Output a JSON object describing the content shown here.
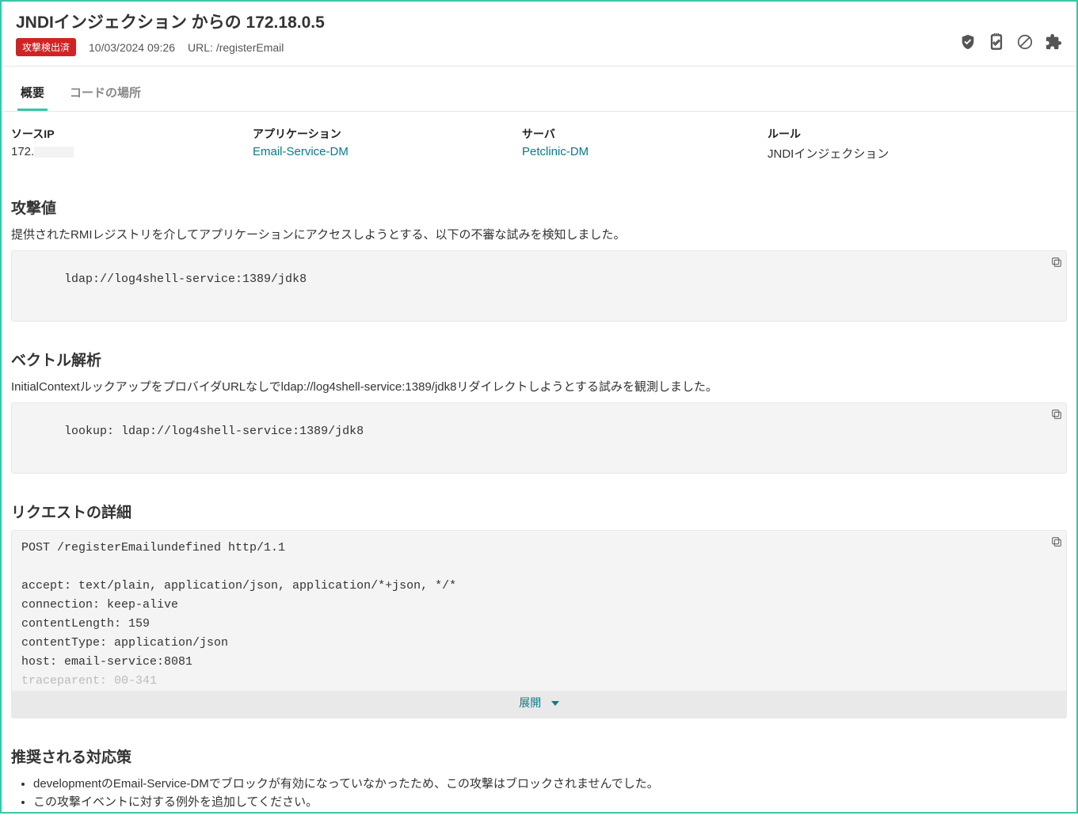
{
  "header": {
    "title": "JNDIインジェクション からの 172.18.0.5",
    "badge": "攻撃検出済",
    "datetime": "10/03/2024 09:26",
    "url_label": "URL:",
    "url_value": "/registerEmail"
  },
  "tabs": {
    "overview": "概要",
    "code_location": "コードの場所"
  },
  "info": {
    "source_ip_label": "ソースIP",
    "source_ip_value": "172.",
    "application_label": "アプリケーション",
    "application_value": "Email-Service-DM",
    "server_label": "サーバ",
    "server_value": "Petclinic-DM",
    "rule_label": "ルール",
    "rule_value": "JNDIインジェクション"
  },
  "attack_value": {
    "title": "攻撃値",
    "desc": "提供されたRMIレジストリを介してアプリケーションにアクセスしようとする、以下の不審な試みを検知しました。",
    "code": "ldap://log4shell-service:1389/jdk8"
  },
  "vector": {
    "title": "ベクトル解析",
    "desc": "InitialContextルックアップをプロバイダURLなしでldap://log4shell-service:1389/jdk8リダイレクトしようとする試みを観測しました。",
    "code": "lookup: ldap://log4shell-service:1389/jdk8"
  },
  "request": {
    "title": "リクエストの詳細",
    "body": "POST /registerEmailundefined http/1.1\n\naccept: text/plain, application/json, application/*+json, */*\nconnection: keep-alive\ncontentLength: 159\ncontentType: application/json\nhost: email-service:8081",
    "faded_line": "traceparent: 00-341",
    "expand": "展開"
  },
  "recommend": {
    "title": "推奨される対応策",
    "item1": "developmentのEmail-Service-DMでブロックが有効になっていなかったため、この攻撃はブロックされませんでした。",
    "item2": "この攻撃イベントに対する例外を追加してください。"
  }
}
